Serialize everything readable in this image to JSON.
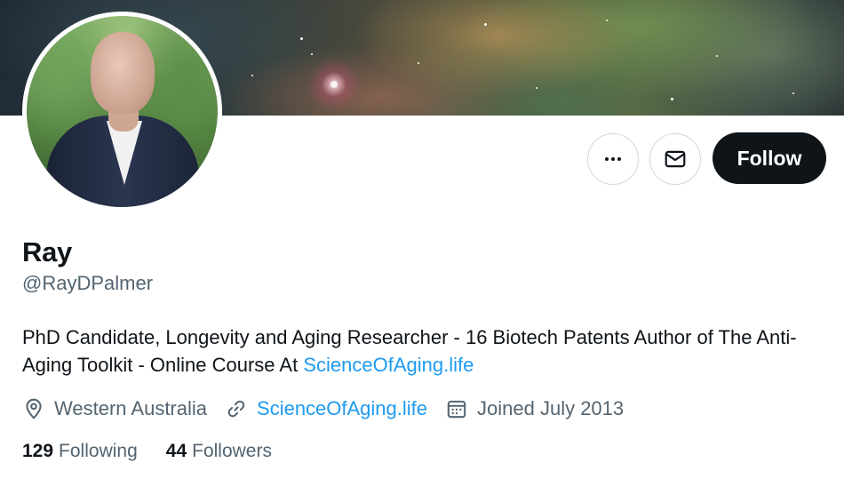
{
  "profile": {
    "name": "Ray",
    "handle": "@RayDPalmer",
    "bio": {
      "text": "PhD Candidate, Longevity and Aging Researcher - 16 Biotech Patents Author of The Anti-Aging Toolkit - Online Course At ",
      "link_text": "ScienceOfAging.life"
    },
    "location": "Western Australia",
    "website": "ScienceOfAging.life",
    "joined": "Joined July 2013",
    "following_count": "129",
    "following_label": "Following",
    "followers_count": "44",
    "followers_label": "Followers"
  },
  "actions": {
    "more_icon": "ellipsis-icon",
    "message_icon": "envelope-icon",
    "follow_label": "Follow"
  },
  "colors": {
    "text_primary": "#0f1419",
    "text_secondary": "#536471",
    "link": "#1d9bf0",
    "follow_button": "#0f1419",
    "border": "#cfd9de"
  },
  "icons": {
    "location": "location-pin-icon",
    "website": "link-icon",
    "joined": "calendar-icon"
  }
}
